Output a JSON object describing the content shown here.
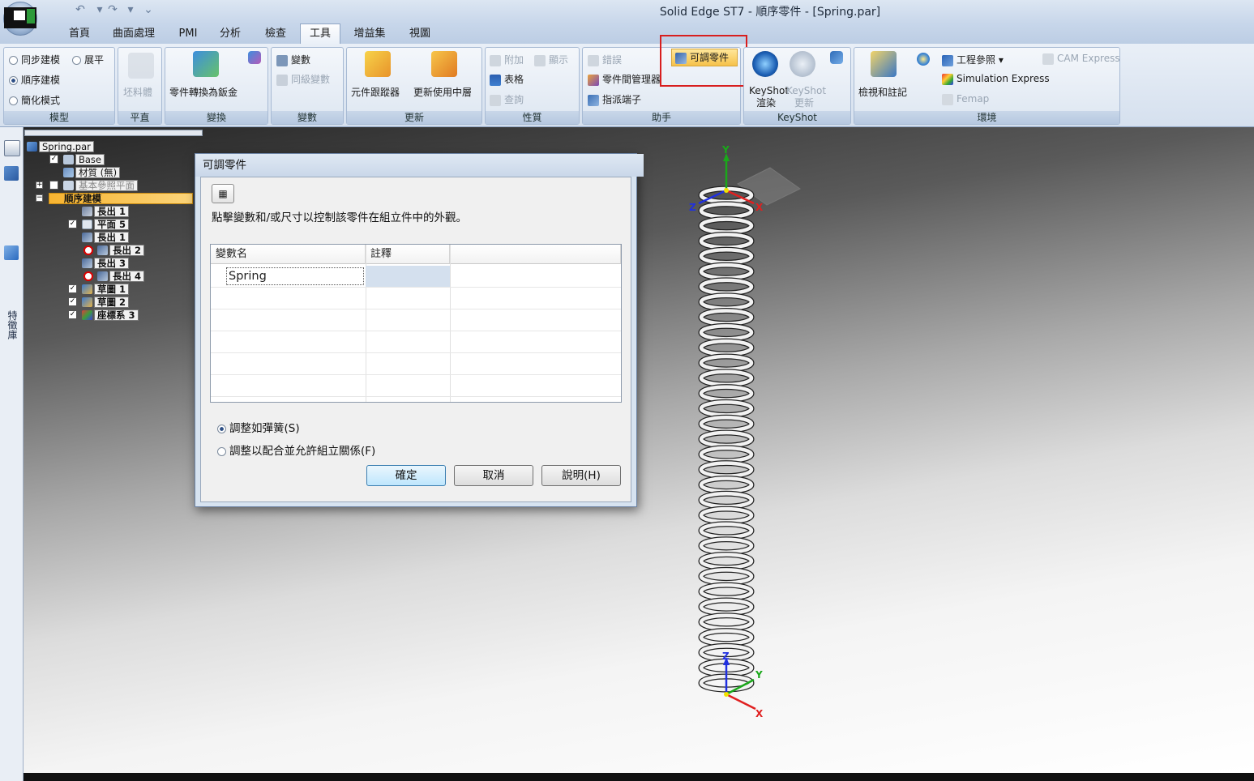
{
  "window": {
    "title": "Solid Edge ST7 - 順序零件 - [Spring.par]"
  },
  "tabs": [
    {
      "label": "首頁"
    },
    {
      "label": "曲面處理"
    },
    {
      "label": "PMI"
    },
    {
      "label": "分析"
    },
    {
      "label": "檢查"
    },
    {
      "label": "工具",
      "active": true
    },
    {
      "label": "增益集"
    },
    {
      "label": "視圖"
    }
  ],
  "ribbon": {
    "model": {
      "sync": "同步建模",
      "flatten": "展平",
      "ordered": "順序建模",
      "simplified": "簡化模式",
      "label": "模型"
    },
    "plane": {
      "blank": "坯料體",
      "label": "平直"
    },
    "convert": {
      "to_sheetmetal": "零件轉換為鈑金",
      "label": "變換"
    },
    "variables": {
      "variables": "變數",
      "peer_vars": "同級變數",
      "label": "變數"
    },
    "update": {
      "tracker": "元件跟蹤器",
      "update_active": "更新使用中層",
      "label": "更新"
    },
    "properties": {
      "attach": "附加",
      "show": "顯示",
      "table": "表格",
      "query": "查詢",
      "label": "性質"
    },
    "assistant": {
      "errors": "錯誤",
      "adjustable": "可調零件",
      "inter_part": "零件間管理器",
      "assign_terminal": "指派端子",
      "label": "助手"
    },
    "keyshot": {
      "render_l1": "KeyShot",
      "render_l2": "渲染",
      "update_l1": "KeyShot",
      "update_l2": "更新",
      "label": "KeyShot"
    },
    "environment": {
      "review": "檢視和註記",
      "eng_ref": "工程參照",
      "cam": "CAM Express",
      "sim": "Simulation Express",
      "femap": "Femap",
      "label": "環境"
    }
  },
  "left_strip": {
    "tab_text": "特徵庫"
  },
  "tree": [
    {
      "label": "Spring.par"
    },
    {
      "label": "Base"
    },
    {
      "label": "材質 (無)"
    },
    {
      "label": "基本參照平面"
    },
    {
      "label": "順序建模"
    },
    {
      "label": "長出 1"
    },
    {
      "label": "平面 5"
    },
    {
      "label": "長出 1"
    },
    {
      "label": "長出 2"
    },
    {
      "label": "長出 3"
    },
    {
      "label": "長出 4"
    },
    {
      "label": "草圖 1"
    },
    {
      "label": "草圖 2"
    },
    {
      "label": "座標系 3"
    }
  ],
  "dialog": {
    "title": "可調零件",
    "instruction": "點擊變數和/或尺寸以控制該零件在組立件中的外觀。",
    "table": {
      "headers": [
        "變數名",
        "註釋",
        ""
      ],
      "rows": [
        [
          "Spring",
          "",
          ""
        ]
      ]
    },
    "options": [
      {
        "label": "調整如彈簧(S)",
        "selected": true
      },
      {
        "label": "調整以配合並允許組立關係(F)",
        "selected": false
      }
    ],
    "buttons": {
      "ok": "確定",
      "cancel": "取消",
      "help": "說明(H)"
    }
  },
  "viewport": {
    "axes_top": {
      "y": "Y",
      "z": "Z",
      "x": "X"
    },
    "axes_bottom": {
      "z": "Z",
      "y": "Y",
      "x": "X"
    }
  },
  "colors": {
    "highlight": "#f6c14a",
    "annotation_box": "#d81e1e",
    "axis_x": "#e02020",
    "axis_y": "#20b020",
    "axis_z": "#2030e0"
  }
}
